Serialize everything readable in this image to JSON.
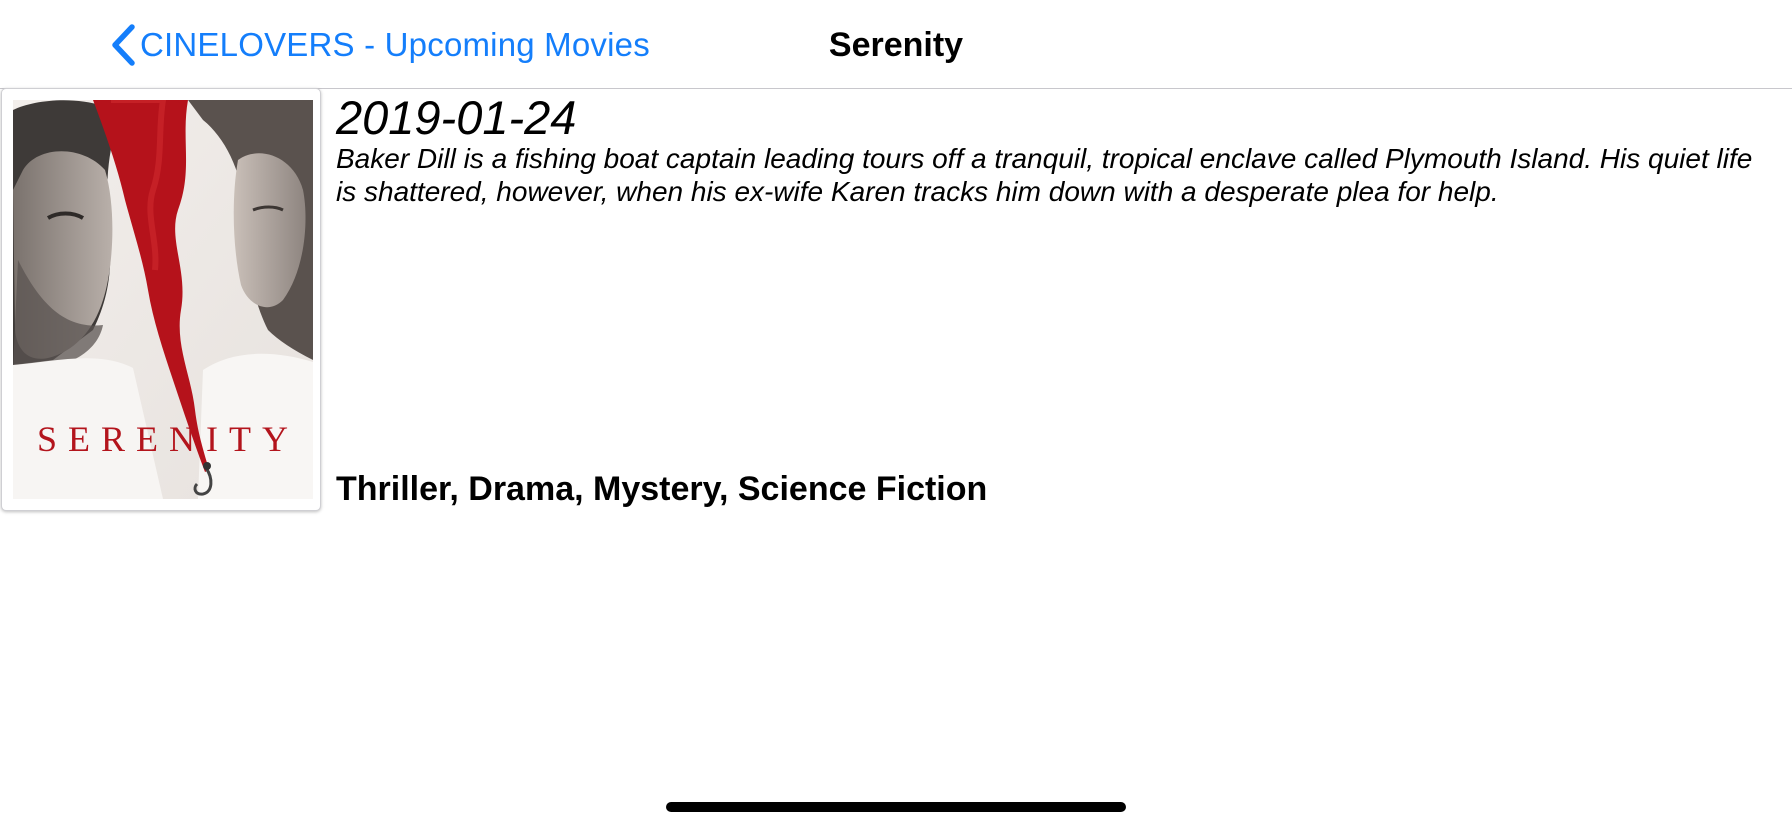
{
  "navbar": {
    "back_label": "CINELOVERS - Upcoming Movies",
    "back_icon": "chevron-left-icon",
    "title": "Serenity",
    "accent_color": "#147efb"
  },
  "movie": {
    "poster_title": "SERENITY",
    "release_date": "2019-01-24",
    "overview": "Baker Dill is a fishing boat captain leading tours off a tranquil, tropical enclave called Plymouth Island. His quiet life is shattered, however, when his ex-wife Karen tracks him down with a desperate plea for help.",
    "genres": "Thriller, Drama, Mystery, Science Fiction"
  }
}
